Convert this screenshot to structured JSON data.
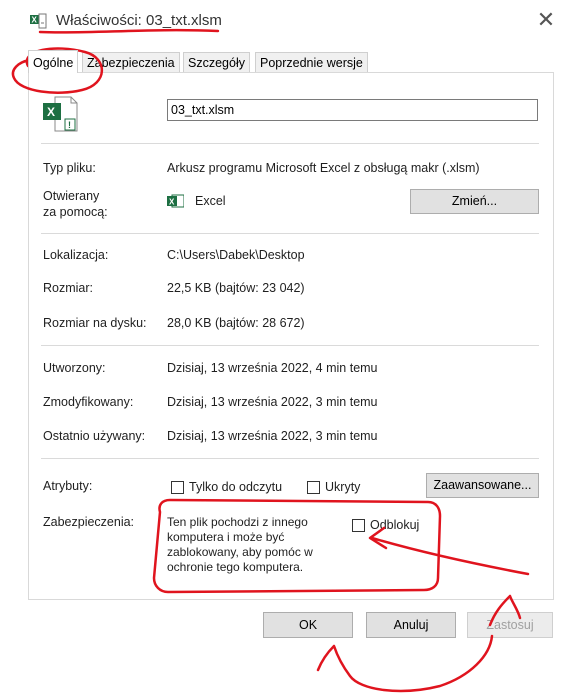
{
  "window": {
    "title": "Właściwości: 03_txt.xlsm",
    "close_glyph": "✕"
  },
  "tabs": [
    {
      "label": "Ogólne",
      "active": true
    },
    {
      "label": "Zabezpieczenia",
      "active": false
    },
    {
      "label": "Szczegóły",
      "active": false
    },
    {
      "label": "Poprzednie wersje",
      "active": false
    }
  ],
  "general": {
    "file_name": "03_txt.xlsm",
    "file_type_label": "Typ pliku:",
    "file_type_value": "Arkusz programu Microsoft Excel z obsługą makr (.xlsm)",
    "opens_with_label_1": "Otwierany",
    "opens_with_label_2": "za pomocą:",
    "opens_with_app": "Excel",
    "change_button": "Zmień...",
    "location_label": "Lokalizacja:",
    "location_value": "C:\\Users\\Dabek\\Desktop",
    "size_label": "Rozmiar:",
    "size_value": "22,5 KB (bajtów: 23 042)",
    "size_on_disk_label": "Rozmiar na dysku:",
    "size_on_disk_value": "28,0 KB (bajtów: 28 672)",
    "created_label": "Utworzony:",
    "created_value": "Dzisiaj, 13 września 2022, 4 min temu",
    "modified_label": "Zmodyfikowany:",
    "modified_value": "Dzisiaj, 13 września 2022, 3 min temu",
    "accessed_label": "Ostatnio używany:",
    "accessed_value": "Dzisiaj, 13 września 2022, 3 min temu",
    "attributes_label": "Atrybuty:",
    "readonly_label": "Tylko do odczytu",
    "hidden_label": "Ukryty",
    "advanced_button": "Zaawansowane...",
    "security_label": "Zabezpieczenia:",
    "security_line_1": "Ten plik pochodzi z innego",
    "security_line_2": "komputera i może być",
    "security_line_3": "zablokowany, aby pomóc w",
    "security_line_4": "ochronie tego komputera.",
    "unblock_label": "Odblokuj"
  },
  "footer": {
    "ok": "OK",
    "cancel": "Anuluj",
    "apply": "Zastosuj"
  },
  "colors": {
    "annotation": "#e0141e",
    "excel_green": "#1d6f42"
  }
}
